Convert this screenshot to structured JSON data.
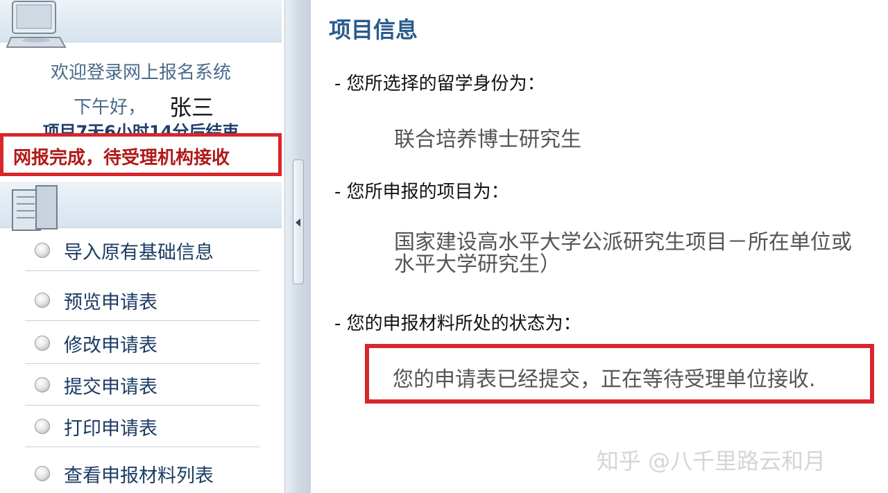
{
  "sidebar": {
    "welcome": "欢迎登录网上报名系统",
    "greeting": "下午好，",
    "username": "张三",
    "countdown": "项目7天6小时14分后结束",
    "status": "网报完成，待受理机构接收",
    "menu": [
      {
        "label": "导入原有基础信息"
      },
      {
        "label": "预览申请表"
      },
      {
        "label": "修改申请表"
      },
      {
        "label": "提交申请表"
      },
      {
        "label": "打印申请表"
      },
      {
        "label": "查看申报材料列表"
      }
    ]
  },
  "main": {
    "title": "项目信息",
    "identity_label": "- 您所选择的留学身份为：",
    "identity_value": "联合培养博士研究生",
    "project_label": "- 您所申报的项目为：",
    "project_value_line1": "国家建设高水平大学公派研究生项目－所在单位或",
    "project_value_line2": "水平大学研究生）",
    "state_label": "- 您的申报材料所处的状态为：",
    "state_value": "您的申请表已经提交，正在等待受理单位接收."
  },
  "watermark": "知乎 @八千里路云和月",
  "icons": {
    "computer": "computer-icon",
    "book": "book-icon",
    "bullet": "bullet-icon",
    "collapse": "collapse-arrow-icon"
  },
  "colors": {
    "highlight_border": "#d8262a",
    "title_blue": "#2a5b8c",
    "status_red": "#b21818"
  }
}
